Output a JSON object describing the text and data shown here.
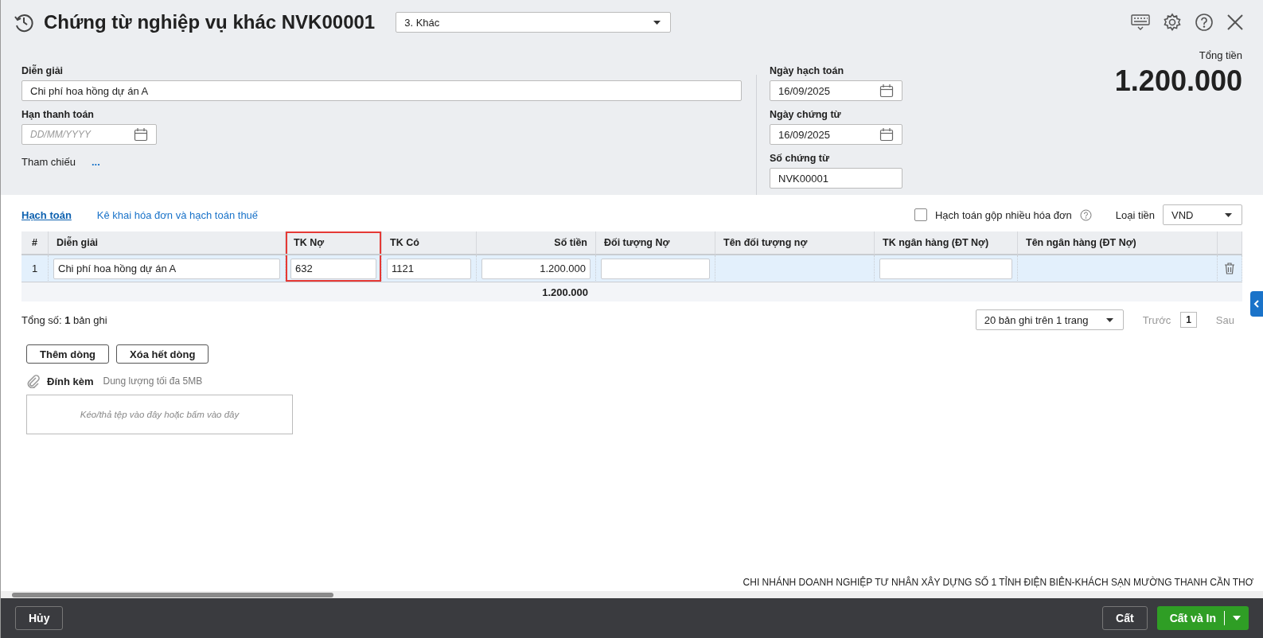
{
  "window": {
    "title": "Chứng từ nghiệp vụ khác NVK00001",
    "voucher_type": "3. Khác"
  },
  "description": {
    "label": "Diễn giải",
    "value": "Chi phí hoa hồng dự án A"
  },
  "due_date": {
    "label": "Hạn thanh toán",
    "placeholder": "DD/MM/YYYY"
  },
  "reference": {
    "label": "Tham chiếu",
    "link": "..."
  },
  "posting_date": {
    "label": "Ngày hạch toán",
    "value": "16/09/2025"
  },
  "voucher_date": {
    "label": "Ngày chứng từ",
    "value": "16/09/2025"
  },
  "voucher_no": {
    "label": "Số chứng từ",
    "value": "NVK00001"
  },
  "total": {
    "label": "Tổng tiền",
    "value": "1.200.000"
  },
  "tabs": [
    {
      "label": "Hạch toán",
      "selected": true
    },
    {
      "label": "Kê khai hóa đơn và hạch toán thuế",
      "selected": false
    }
  ],
  "merge_invoices": {
    "label": "Hạch toán gộp nhiều hóa đơn",
    "checked": false
  },
  "currency": {
    "label": "Loại tiền",
    "value": "VND"
  },
  "table": {
    "columns": [
      {
        "label": "#",
        "highlighted": false
      },
      {
        "label": "Diễn giải",
        "highlighted": false
      },
      {
        "label": "TK Nợ",
        "highlighted": true
      },
      {
        "label": "TK Có",
        "highlighted": false
      },
      {
        "label": "Số tiền",
        "highlighted": false,
        "total": "1.200.000"
      },
      {
        "label": "Đối tượng Nợ",
        "highlighted": false
      },
      {
        "label": "Tên đối tượng nợ",
        "highlighted": false
      },
      {
        "label": "TK ngân hàng (ĐT Nợ)",
        "highlighted": false
      },
      {
        "label": "Tên ngân hàng (ĐT Nợ)",
        "highlighted": false
      },
      {
        "highlighted": false
      }
    ],
    "rows": [
      {
        "selected": true,
        "cells": [
          {
            "kind": "text",
            "value": "1"
          },
          {
            "kind": "input",
            "value": "Chi phí hoa hồng dự án A"
          },
          {
            "kind": "input",
            "value": "632"
          },
          {
            "kind": "input",
            "value": "1121"
          },
          {
            "kind": "input",
            "value": "1.200.000"
          },
          {
            "kind": "input"
          },
          {
            "kind": "blank"
          },
          {
            "kind": "input"
          },
          {
            "kind": "blank"
          },
          {
            "kind": "delete"
          }
        ]
      }
    ]
  },
  "record_count": "Tổng số: **1** bản ghi",
  "pager": {
    "page_size": "20 bản ghi trên 1 trang",
    "previous": {
      "label": "Trước",
      "disabled": true
    },
    "page": "1",
    "next": {
      "label": "Sau",
      "disabled": true
    }
  },
  "row_buttons": [
    "Thêm dòng",
    "Xóa hết dòng"
  ],
  "attachment": {
    "label": "Đính kèm",
    "hint": "Dung lượng tối đa 5MB",
    "drop_placeholder": "Kéo/thả tệp vào đây hoặc bấm vào đây"
  },
  "company": "CHI NHÁNH DOANH NGHIỆP TƯ NHÂN XÂY DỰNG SỐ 1 TỈNH ĐIỆN BIÊN-KHÁCH SẠN MƯỜNG THANH CẦN THƠ",
  "footer": {
    "cancel": "Hủy",
    "save": "Cất",
    "save_print": "Cất và In"
  }
}
